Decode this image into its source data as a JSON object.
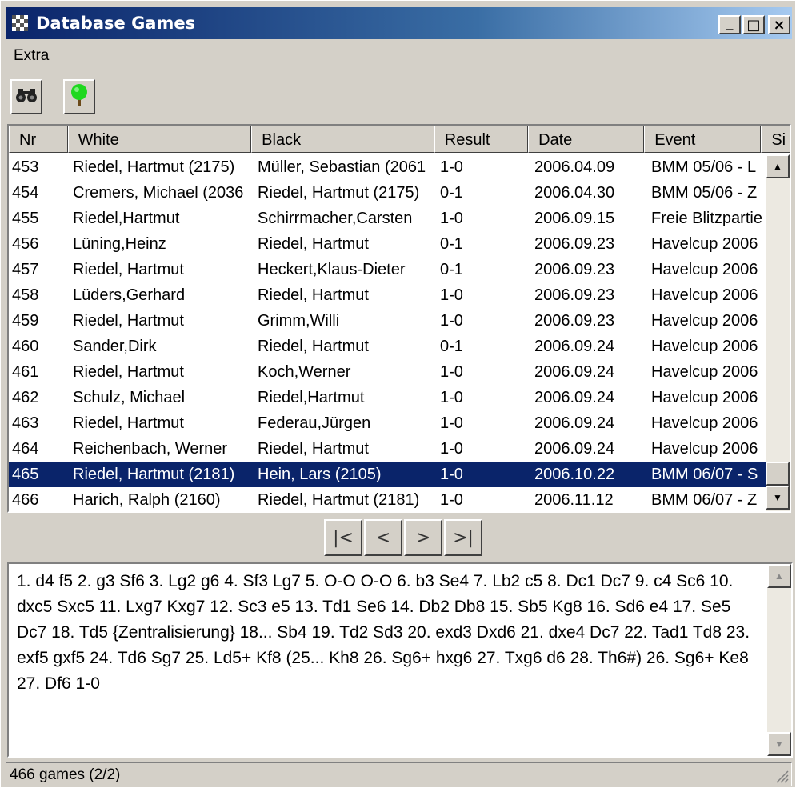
{
  "window": {
    "title": "Database Games",
    "minimize": "_",
    "maximize": "□",
    "close": "×"
  },
  "menu": {
    "extra": "Extra"
  },
  "toolbar": {
    "search_icon": "binoculars-icon",
    "tree_icon": "tree-icon"
  },
  "grid": {
    "columns": [
      "Nr",
      "White",
      "Black",
      "Result",
      "Date",
      "Event",
      "Si"
    ],
    "rows": [
      [
        "453",
        "Riedel, Hartmut (2175)",
        "Müller, Sebastian (2061",
        "1-0",
        "2006.04.09",
        "BMM 05/06 - L"
      ],
      [
        "454",
        "Cremers, Michael (2036",
        "Riedel, Hartmut (2175)",
        "0-1",
        "2006.04.30",
        "BMM 05/06 - Z"
      ],
      [
        "455",
        "Riedel,Hartmut",
        "Schirrmacher,Carsten",
        "1-0",
        "2006.09.15",
        "Freie Blitzpartie"
      ],
      [
        "456",
        "Lüning,Heinz",
        "Riedel, Hartmut",
        "0-1",
        "2006.09.23",
        "Havelcup 2006"
      ],
      [
        "457",
        "Riedel, Hartmut",
        "Heckert,Klaus-Dieter",
        "0-1",
        "2006.09.23",
        "Havelcup 2006"
      ],
      [
        "458",
        "Lüders,Gerhard",
        "Riedel, Hartmut",
        "1-0",
        "2006.09.23",
        "Havelcup 2006"
      ],
      [
        "459",
        "Riedel, Hartmut",
        "Grimm,Willi",
        "1-0",
        "2006.09.23",
        "Havelcup 2006"
      ],
      [
        "460",
        "Sander,Dirk",
        "Riedel, Hartmut",
        "0-1",
        "2006.09.24",
        "Havelcup 2006"
      ],
      [
        "461",
        "Riedel, Hartmut",
        "Koch,Werner",
        "1-0",
        "2006.09.24",
        "Havelcup 2006"
      ],
      [
        "462",
        "Schulz, Michael",
        "Riedel,Hartmut",
        "1-0",
        "2006.09.24",
        "Havelcup 2006"
      ],
      [
        "463",
        "Riedel, Hartmut",
        "Federau,Jürgen",
        "1-0",
        "2006.09.24",
        "Havelcup 2006"
      ],
      [
        "464",
        "Reichenbach, Werner",
        "Riedel, Hartmut",
        "1-0",
        "2006.09.24",
        "Havelcup 2006"
      ],
      [
        "465",
        "Riedel, Hartmut (2181)",
        "Hein, Lars (2105)",
        "1-0",
        "2006.10.22",
        "BMM 06/07 - S"
      ],
      [
        "466",
        "Harich, Ralph (2160)",
        "Riedel, Hartmut (2181)",
        "1-0",
        "2006.11.12",
        "BMM 06/07 - Z"
      ]
    ],
    "selected_row": 12,
    "selection_color": "#0a246a"
  },
  "nav": {
    "first": "|<",
    "prev": "<",
    "next": ">",
    "last": ">|"
  },
  "notation": {
    "text": "1. d4 f5 2. g3 Sf6 3. Lg2 g6 4. Sf3 Lg7 5. O-O O-O 6. b3 Se4 7. Lb2 c5 8. Dc1 Dc7 9. c4 Sc6 10. dxc5 Sxc5 11. Lxg7 Kxg7 12. Sc3 e5 13. Td1 Se6 14. Db2 Db8 15. Sb5 Kg8 16. Sd6 e4 17. Se5 Dc7 18. Td5 {Zentralisierung} 18... Sb4 19. Td2 Sd3 20. exd3 Dxd6 21. dxe4 Dc7 22. Tad1 Td8 23. exf5 gxf5 24. Td6 Sg7 25. Ld5+ Kf8 (25... Kh8 26. Sg6+ hxg6 27. Txg6 d6 28. Th6#) 26. Sg6+ Ke8 27. Df6 1-0"
  },
  "status": {
    "text": "466 games (2/2)"
  }
}
